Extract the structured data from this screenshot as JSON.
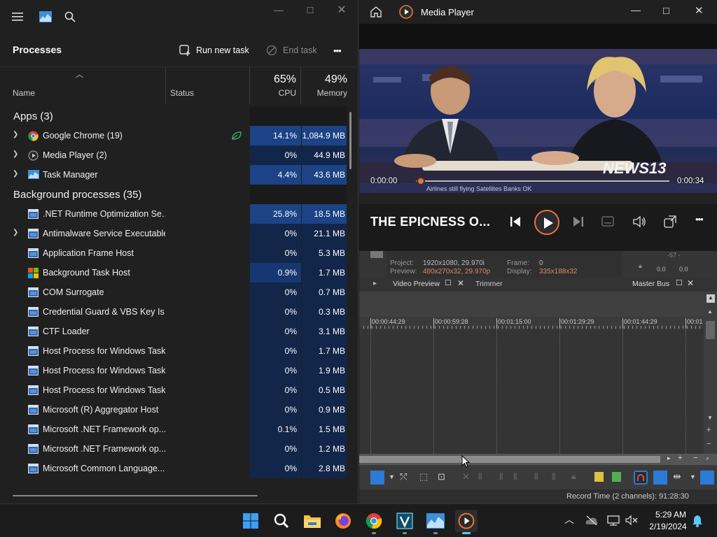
{
  "task_manager": {
    "header_title": "Processes",
    "run_new_task": "Run new task",
    "end_task": "End task",
    "more": "•••",
    "col_name": "Name",
    "col_status": "Status",
    "cpu_pct": "65%",
    "cpu_label": "CPU",
    "mem_pct": "49%",
    "mem_label": "Memory",
    "apps_header": "Apps (3)",
    "bg_header": "Background processes (35)",
    "apps": [
      {
        "name": "Google Chrome (19)",
        "cpu": "14.1%",
        "mem": "1,084.9 MB",
        "icon": "chrome-icon",
        "expand": true,
        "eco": true
      },
      {
        "name": "Media Player (2)",
        "cpu": "0%",
        "mem": "44.9 MB",
        "icon": "media-player-icon",
        "expand": true
      },
      {
        "name": "Task Manager",
        "cpu": "4.4%",
        "mem": "43.6 MB",
        "icon": "task-manager-icon",
        "expand": true
      }
    ],
    "background": [
      {
        "name": ".NET Runtime Optimization Se...",
        "cpu": "25.8%",
        "mem": "18.5 MB",
        "icon": "window-icon"
      },
      {
        "name": "Antimalware Service Executable",
        "cpu": "0%",
        "mem": "21.1 MB",
        "icon": "window-icon",
        "expand": true
      },
      {
        "name": "Application Frame Host",
        "cpu": "0%",
        "mem": "5.3 MB",
        "icon": "window-icon"
      },
      {
        "name": "Background Task Host",
        "cpu": "0.9%",
        "mem": "1.7 MB",
        "icon": "windows-logo-icon"
      },
      {
        "name": "COM Surrogate",
        "cpu": "0%",
        "mem": "0.7 MB",
        "icon": "window-icon"
      },
      {
        "name": "Credential Guard & VBS Key Is...",
        "cpu": "0%",
        "mem": "0.3 MB",
        "icon": "window-icon"
      },
      {
        "name": "CTF Loader",
        "cpu": "0%",
        "mem": "3.1 MB",
        "icon": "window-icon"
      },
      {
        "name": "Host Process for Windows Tasks",
        "cpu": "0%",
        "mem": "1.7 MB",
        "icon": "window-icon"
      },
      {
        "name": "Host Process for Windows Tasks",
        "cpu": "0%",
        "mem": "1.9 MB",
        "icon": "window-icon"
      },
      {
        "name": "Host Process for Windows Tasks",
        "cpu": "0%",
        "mem": "0.5 MB",
        "icon": "window-icon"
      },
      {
        "name": "Microsoft (R) Aggregator Host",
        "cpu": "0%",
        "mem": "0.9 MB",
        "icon": "window-icon"
      },
      {
        "name": "Microsoft .NET Framework op...",
        "cpu": "0.1%",
        "mem": "1.5 MB",
        "icon": "window-icon"
      },
      {
        "name": "Microsoft .NET Framework op...",
        "cpu": "0%",
        "mem": "1.2 MB",
        "icon": "window-icon"
      },
      {
        "name": "Microsoft Common Language...",
        "cpu": "0%",
        "mem": "2.8 MB",
        "icon": "window-icon"
      }
    ]
  },
  "media_player": {
    "title": "Media Player",
    "elapsed": "0:00:00",
    "remaining": "0:00:34",
    "progress": 0.02,
    "track_title": "THE EPICNESS O...",
    "ticker": "Airlines still flying  Satellites  Banks OK",
    "logo": "NEWS13"
  },
  "editor": {
    "project_label": "Project:",
    "project_value": "1920x1080, 29.970i",
    "preview_label": "Preview:",
    "preview_value": "480x270x32, 29.970p",
    "frame_label": "Frame:",
    "frame_value": "0",
    "display_label": "Display:",
    "display_value": "335x188x32",
    "tab_video_preview": "Video Preview",
    "tab_trimmer": "Trimmer",
    "tab_master_bus": "Master Bus",
    "meter_top": "-57 -",
    "meter_left": "0.0",
    "meter_right": "0.0",
    "timecodes": [
      "00:00:44:29",
      "00:00:59:28",
      "00:01:15:00",
      "00:01:29:29",
      "00:01:44:29",
      "00:01"
    ],
    "record_time": "Record Time (2 channels): 91:28:30"
  },
  "taskbar": {
    "time": "5:29 AM",
    "date": "2/19/2024"
  }
}
